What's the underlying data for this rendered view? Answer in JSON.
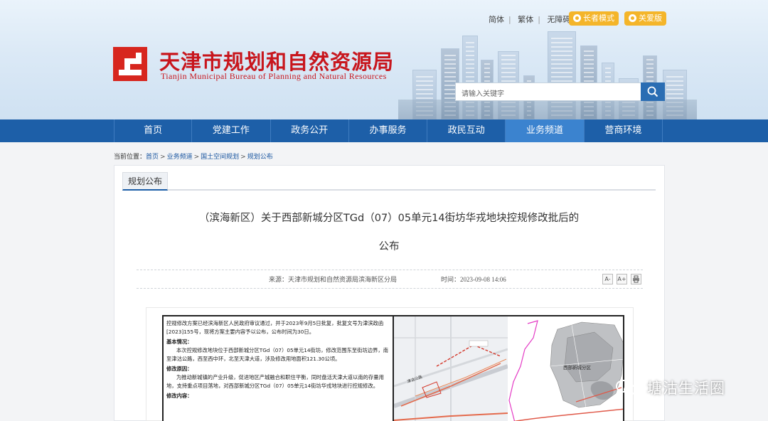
{
  "header": {
    "site_name_cn": "天津市规划和自然资源局",
    "site_name_en": "Tianjin Municipal Bureau of Planning and Natural Resources",
    "top_links": [
      "简体",
      "繁体",
      "无障碍服务"
    ],
    "elder_mode": "长者模式",
    "care_version": "关爱版",
    "search_placeholder": "请输入关键字"
  },
  "nav": {
    "items": [
      "首页",
      "党建工作",
      "政务公开",
      "办事服务",
      "政民互动",
      "业务频道",
      "营商环境"
    ],
    "active_index": 5
  },
  "breadcrumb": {
    "label": "当前位置：",
    "items": [
      "首页",
      "业务频道",
      "国土空间规划",
      "规划公布"
    ]
  },
  "section_tab": "规划公布",
  "article": {
    "title_line1": "（滨海新区）关于西部新城分区TGd（07）05单元14街坊华戎地块控规修改批后的",
    "title_line2": "公布",
    "source": "来源：天津市规划和自然资源局滨海新区分局",
    "time": "时间：2023-09-08 14:06",
    "tools": [
      "A-",
      "A+",
      "print"
    ]
  },
  "doc_image": {
    "intro": "控规修改方案已经滨海新区人民政府审议通过，并于2023年9月5日批复，批复文号为津滨政函[2023]155号，现将方案主要内容予以公布，公布时间为30日。",
    "basic_heading": "基本情况：",
    "basic_text": "本次控规修改地块位于西部新城分区TGd（07）05单元14街坊，修改范围东至街坊边界，南至津沽公路，西至西中环，北至天津大道，涉及修改用地面积121.30公顷。",
    "reason_heading": "修改原因：",
    "reason_text": "为推动新城镇的产业升级，促进地区产城融合和职住平衡，同时盘活天津大道以南的存量用地，支持重点项目落地，对西部新城分区TGd（07）05单元14街坊华戎地块进行控规修改。",
    "content_heading": "修改内容：",
    "map_label_road": "津沽公路",
    "map_label_district": "西部新城分区"
  },
  "watermark": "塘沽生活圈"
}
